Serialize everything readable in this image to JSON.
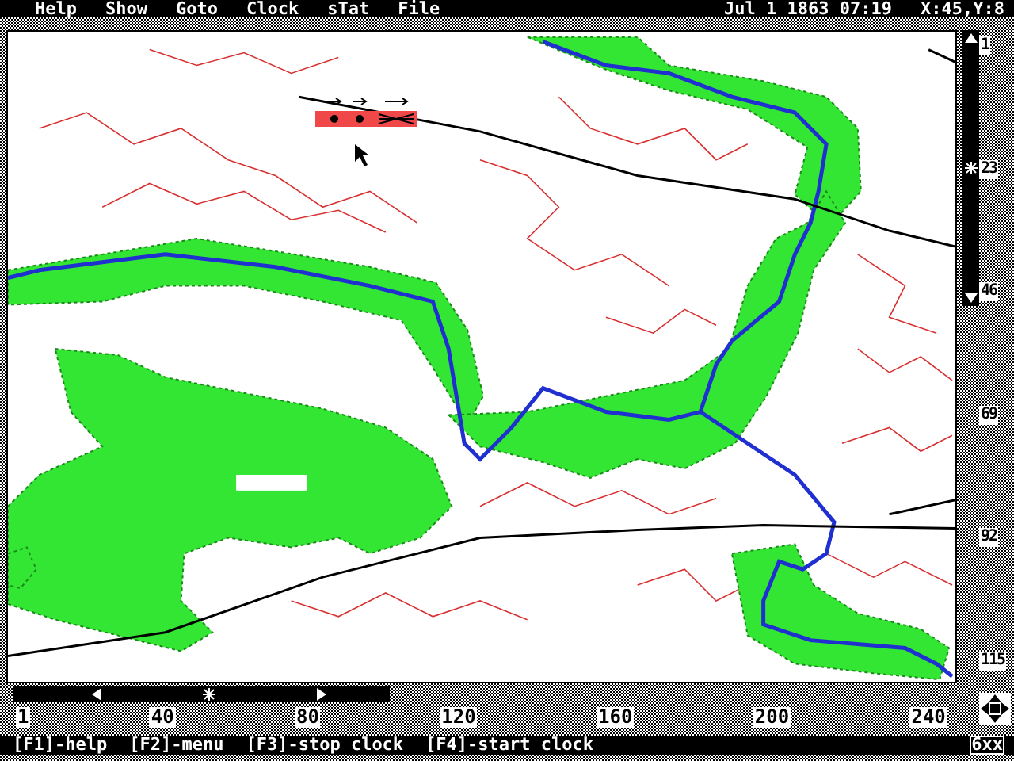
{
  "menu_bar": {
    "items": [
      "Help",
      "Show",
      "Goto",
      "Clock",
      "sTat",
      "File"
    ],
    "date": "Jul 1 1863 07:19",
    "coordinates": "X:45,Y:8"
  },
  "map": {
    "x_scale": [
      "1",
      "40",
      "80",
      "120",
      "160",
      "200",
      "240"
    ],
    "y_scale": [
      "1",
      "23",
      "46",
      "69",
      "92",
      "115"
    ]
  },
  "status_bar": {
    "keys": [
      "[F1]-help",
      "[F2]-menu",
      "[F3]-stop clock",
      "[F4]-start clock"
    ],
    "indicator": "6xx"
  }
}
